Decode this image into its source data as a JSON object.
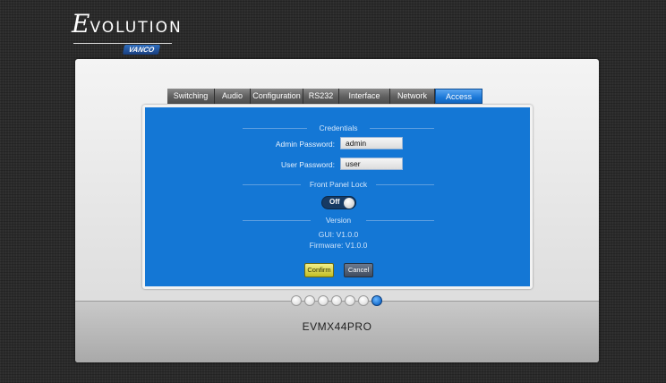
{
  "brand": {
    "title_initial": "E",
    "title_rest": "VOLUTION",
    "sub": "VANCO"
  },
  "tabs": [
    {
      "label": "Switching",
      "active": false
    },
    {
      "label": "Audio",
      "active": false
    },
    {
      "label": "Configuration",
      "active": false
    },
    {
      "label": "RS232",
      "active": false
    },
    {
      "label": "Interface",
      "active": false
    },
    {
      "label": "Network",
      "active": false
    },
    {
      "label": "Access",
      "active": true
    }
  ],
  "credentials": {
    "title": "Credentials",
    "admin_label": "Admin Password:",
    "admin_value": "admin",
    "user_label": "User Password:",
    "user_value": "user"
  },
  "front_panel_lock": {
    "title": "Front Panel Lock",
    "state": "Off"
  },
  "version": {
    "title": "Version",
    "gui": "GUI: V1.0.0",
    "firmware": "Firmware: V1.0.0"
  },
  "buttons": {
    "confirm": "Confirm",
    "cancel": "Cancel"
  },
  "pager": {
    "total": 7,
    "active_index": 6
  },
  "model": "EVMX44PRO",
  "colors": {
    "content_blue": "#1477d5",
    "active_tab": "#1b78d8",
    "confirm": "#c3bd22",
    "cancel": "#404c5e"
  }
}
